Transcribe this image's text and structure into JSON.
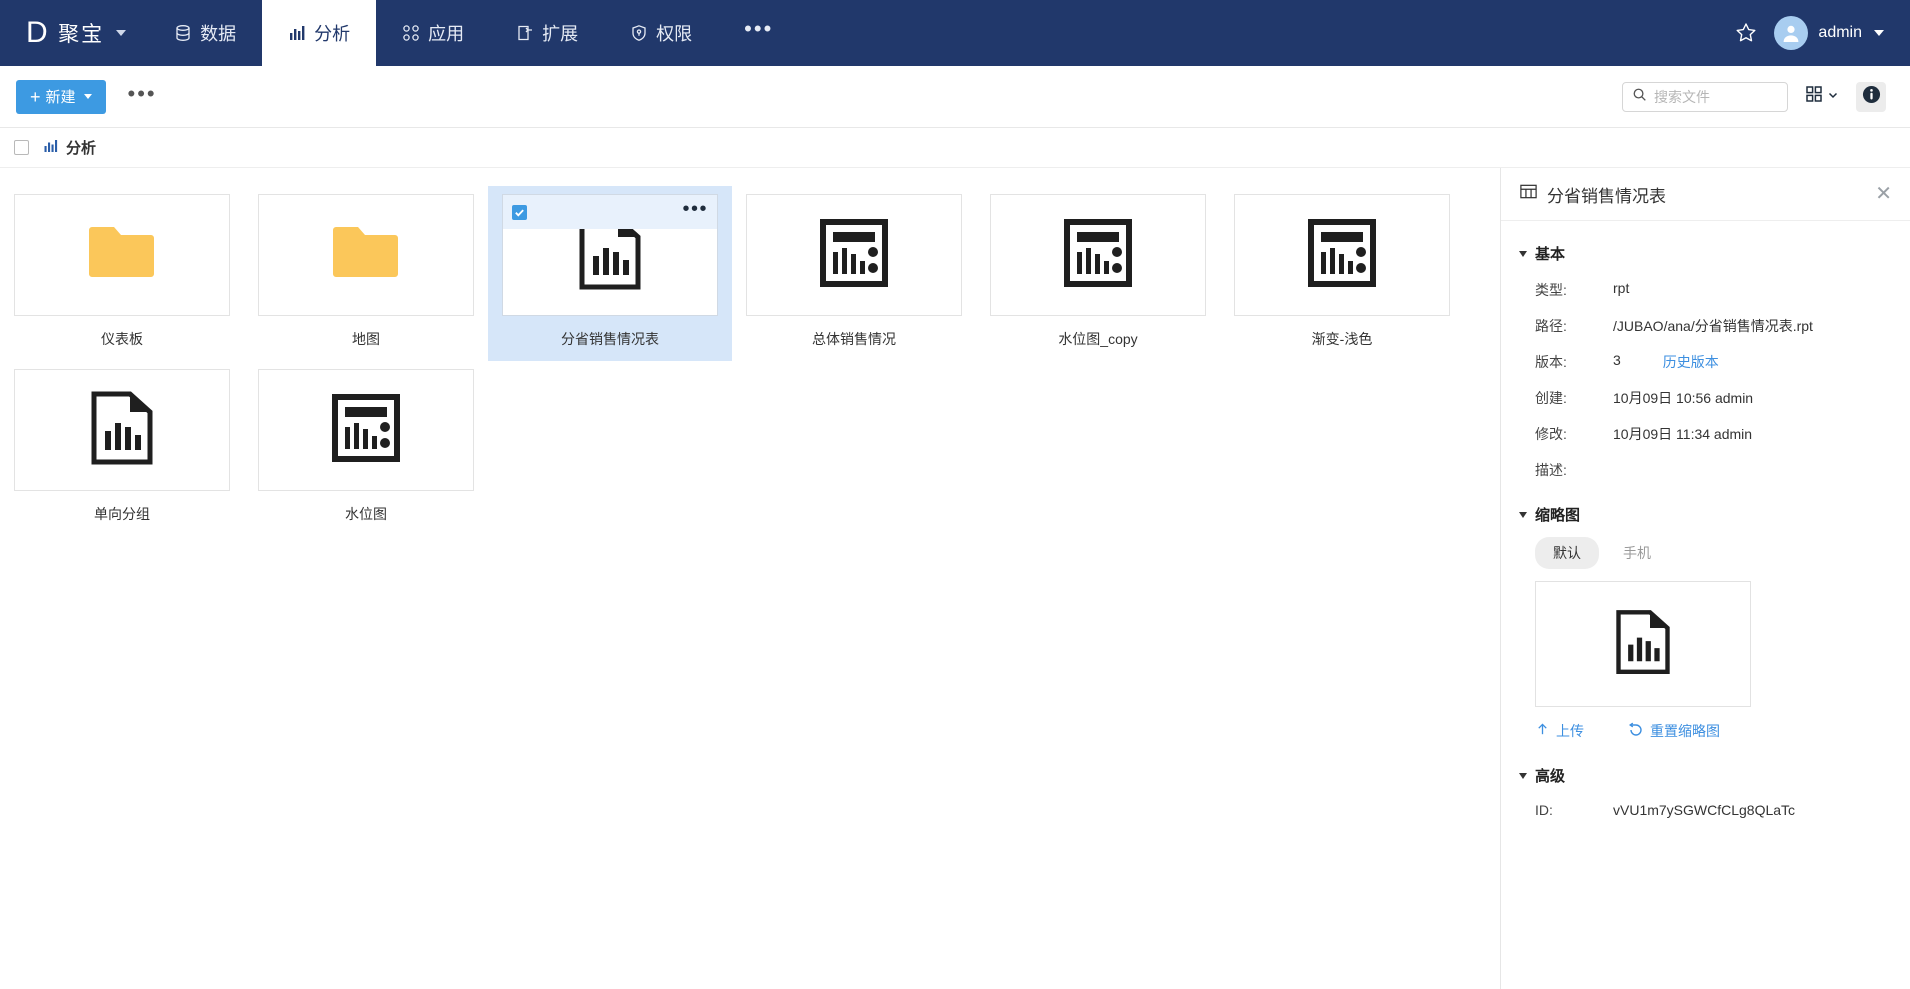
{
  "nav": {
    "brand_logo": "D",
    "brand_name": "聚宝",
    "items": [
      {
        "label": "数据",
        "icon": "database-icon",
        "active": false
      },
      {
        "label": "分析",
        "icon": "bar-chart-icon",
        "active": true
      },
      {
        "label": "应用",
        "icon": "apps-icon",
        "active": false
      },
      {
        "label": "扩展",
        "icon": "extension-icon",
        "active": false
      },
      {
        "label": "权限",
        "icon": "shield-icon",
        "active": false
      }
    ],
    "more_label": "•••",
    "star_icon": "star-icon",
    "user_name": "admin"
  },
  "toolbar": {
    "new_label": "新建",
    "more_label": "•••",
    "search_placeholder": "搜索文件",
    "search_value": "",
    "view_icon": "grid-view-icon",
    "info_icon": "info-icon"
  },
  "breadcrumb": {
    "checkbox_checked": false,
    "icon": "bar-chart-icon",
    "label": "分析"
  },
  "grid": {
    "cards": [
      {
        "label": "仪表板",
        "icon": "folder-icon",
        "selected": false
      },
      {
        "label": "地图",
        "icon": "folder-icon",
        "selected": false
      },
      {
        "label": "分省销售情况表",
        "icon": "report-doc-icon",
        "selected": true
      },
      {
        "label": "总体销售情况",
        "icon": "dashboard-icon",
        "selected": false
      },
      {
        "label": "水位图_copy",
        "icon": "dashboard-icon",
        "selected": false
      },
      {
        "label": "渐变-浅色",
        "icon": "dashboard-icon",
        "selected": false
      },
      {
        "label": "单向分组",
        "icon": "report-doc-icon",
        "selected": false
      },
      {
        "label": "水位图",
        "icon": "dashboard-icon",
        "selected": false
      }
    ]
  },
  "detail": {
    "icon": "table-icon",
    "title": "分省销售情况表",
    "close_label": "✕",
    "basic": {
      "section_label": "基本",
      "type_label": "类型:",
      "type_value": "rpt",
      "path_label": "路径:",
      "path_value": "/JUBAO/ana/分省销售情况表.rpt",
      "version_label": "版本:",
      "version_value": "3",
      "version_history_link": "历史版本",
      "created_label": "创建:",
      "created_value": "10月09日 10:56 admin",
      "modified_label": "修改:",
      "modified_value": "10月09日 11:34 admin",
      "desc_label": "描述:",
      "desc_value": ""
    },
    "thumbnail": {
      "section_label": "缩略图",
      "tabs": [
        {
          "label": "默认",
          "active": true
        },
        {
          "label": "手机",
          "active": false
        }
      ],
      "preview_icon": "report-doc-icon",
      "upload_label": "上传",
      "reset_label": "重置缩略图"
    },
    "advanced": {
      "section_label": "高级",
      "id_label": "ID:",
      "id_value": "vVU1m7ySGWCfCLg8QLaTc"
    }
  },
  "colors": {
    "nav_bg": "#21386b",
    "accent_blue": "#3d9ae2",
    "link_blue": "#3d8fe0",
    "folder_yellow": "#fbc75a",
    "selection_bg": "#d6e6f9"
  }
}
